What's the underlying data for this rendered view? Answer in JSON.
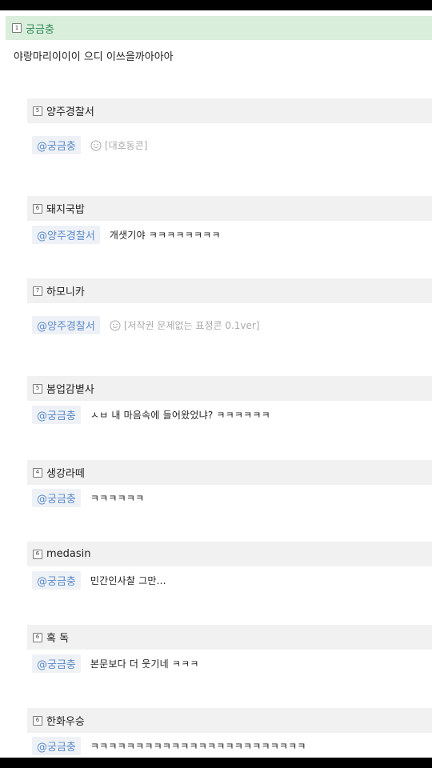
{
  "op": {
    "badge": "1",
    "name": "궁금충",
    "text": "야랑마리이이이 으디 이쓰을까아아아"
  },
  "replies": [
    {
      "badge": "5",
      "name": "양주경찰서",
      "mention": "@궁금충",
      "emoticon": "[대호동콘]"
    },
    {
      "badge": "6",
      "name": "돼지국밥",
      "mention": "@양주경찰서",
      "text": "개샛기야 ㅋㅋㅋㅋㅋㅋㅋㅋ"
    },
    {
      "badge": "7",
      "name": "하모니카",
      "mention": "@양주경찰서",
      "emoticon": "[저작권 문제없는 표정콘 0.1ver]"
    },
    {
      "badge": "5",
      "name": "봄업감볕사",
      "mention": "@궁금충",
      "text": "ㅅㅂ 내 마음속에 들어왔었냐? ㅋㅋㅋㅋㅋㅋ"
    },
    {
      "badge": "4",
      "name": "생강라떼",
      "mention": "@궁금충",
      "text": "ㅋㅋㅋㅋㅋㅋ"
    },
    {
      "badge": "6",
      "name": "medasin",
      "mention": "@궁금충",
      "text": "민간인사찰 그만..."
    },
    {
      "badge": "6",
      "name": "혹 독",
      "mention": "@궁금충",
      "text": "본문보다 더 웃기네 ㅋㅋㅋ"
    },
    {
      "badge": "6",
      "name": "한화우승",
      "mention": "@궁금충",
      "text": "ㅋㅋㅋㅋㅋㅋㅋㅋㅋㅋㅋㅋㅋㅋㅋㅋㅋㅋㅋㅋㅋㅋㅋㅋ"
    }
  ]
}
